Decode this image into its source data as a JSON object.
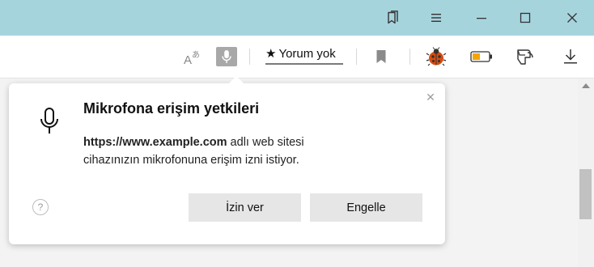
{
  "titlebar": {
    "bookmarks_icon": "bookmarks-icon",
    "menu_icon": "hamburger-icon",
    "minimize_icon": "minimize-icon",
    "maximize_icon": "maximize-icon",
    "close_icon": "close-icon"
  },
  "toolbar": {
    "translate_icon": "translate-icon",
    "mic_icon": "microphone-icon",
    "reviews_star": "★",
    "reviews_label": "Yorum yok",
    "bookmark_icon": "bookmark-icon",
    "ladybug_icon": "ladybug-icon",
    "battery_icon": "battery-icon",
    "protect_icon": "protect-icon",
    "download_icon": "download-icon"
  },
  "popup": {
    "title": "Mikrofona erişim yetkileri",
    "url": "https://www.example.com",
    "body_line1_rest": " adlı web sitesi",
    "body_line2": "cihazınızın mikrofonuna erişim izni istiyor.",
    "close_glyph": "✕",
    "help_glyph": "?",
    "allow_label": "İzin ver",
    "block_label": "Engelle"
  },
  "colors": {
    "titlebar_bg": "#a6d4dd",
    "battery_fill": "#f5a500",
    "ladybug": "#d84c10"
  }
}
